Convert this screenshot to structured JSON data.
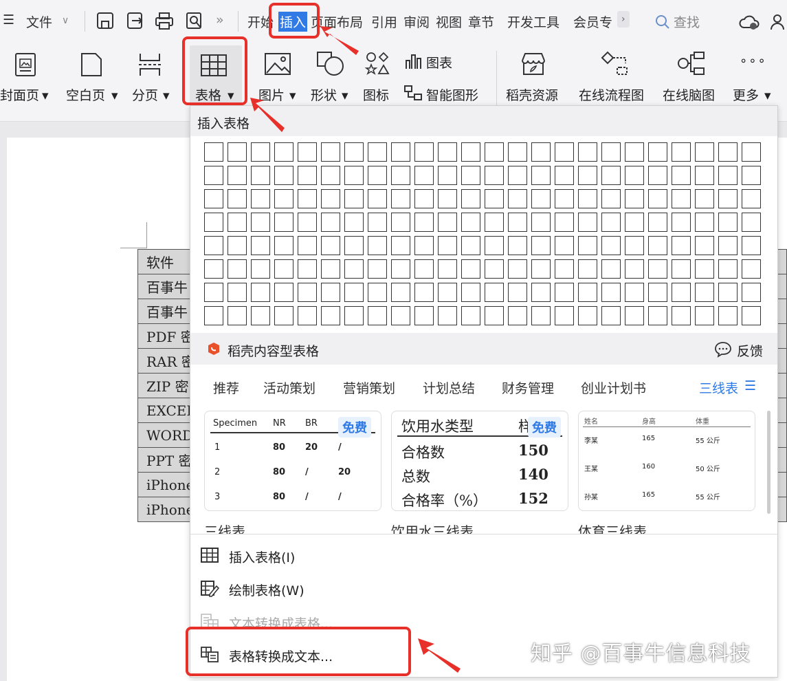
{
  "menubar": {
    "hamburger": "☰",
    "file": "文件",
    "more_glyph": "»",
    "tabs": [
      "开始",
      "插入",
      "页面布局",
      "引用",
      "审阅",
      "视图",
      "章节",
      "开发工具",
      "会员专"
    ],
    "active_tab": "插入",
    "search": "查找"
  },
  "ribbon": {
    "cover": "封面页",
    "blank": "空白页",
    "break": "分页",
    "table": "表格",
    "picture": "图片",
    "shape": "形状",
    "icon": "图标",
    "chart": "图表",
    "smart": "智能图形",
    "daoke": "稻壳资源",
    "flow": "在线流程图",
    "mind": "在线脑图",
    "more": "更多"
  },
  "document_table": {
    "rows": [
      "软件",
      "百事牛",
      "百事牛",
      "PDF 密",
      "RAR 密",
      "ZIP 密",
      "EXCEL",
      "WORD",
      "PPT 密",
      "iPhone",
      "iPhone"
    ]
  },
  "dropdown": {
    "title": "插入表格",
    "grid_rows": 8,
    "grid_cols": 24,
    "daoke_title": "稻壳内容型表格",
    "feedback": "反馈",
    "tabs": [
      "推荐",
      "活动策划",
      "营销策划",
      "计划总结",
      "财务管理",
      "创业计划书"
    ],
    "three_line": "三线表",
    "card1": {
      "headers": [
        "Specimen",
        "NR",
        "BR"
      ],
      "rows": [
        [
          "1",
          "80",
          "20",
          "/"
        ],
        [
          "2",
          "80",
          "/",
          "20"
        ],
        [
          "3",
          "80",
          "/",
          "/"
        ]
      ],
      "badge": "免费"
    },
    "card2": {
      "header": [
        "饮用水类型",
        "样"
      ],
      "rows": [
        [
          "合格数",
          "150"
        ],
        [
          "总数",
          "140"
        ],
        [
          "合格率（%）",
          "152"
        ]
      ],
      "badge": "免费"
    },
    "card3": {
      "headers": [
        "姓名",
        "身高",
        "体重"
      ],
      "rows": [
        [
          "李某",
          "165",
          "55 公斤"
        ],
        [
          "王某",
          "160",
          "50 公斤"
        ],
        [
          "孙某",
          "165",
          "55 公斤"
        ]
      ]
    },
    "captions": [
      "三线表",
      "饮用水三线表",
      "体育三线表"
    ],
    "menu": [
      "插入表格(I)",
      "绘制表格(W)",
      "文本转换成表格...",
      "表格转换成文本..."
    ]
  },
  "colors": {
    "accent": "#2f7ae5",
    "highlight": "#e8302a"
  },
  "watermark": "知乎 @百事牛信息科技"
}
